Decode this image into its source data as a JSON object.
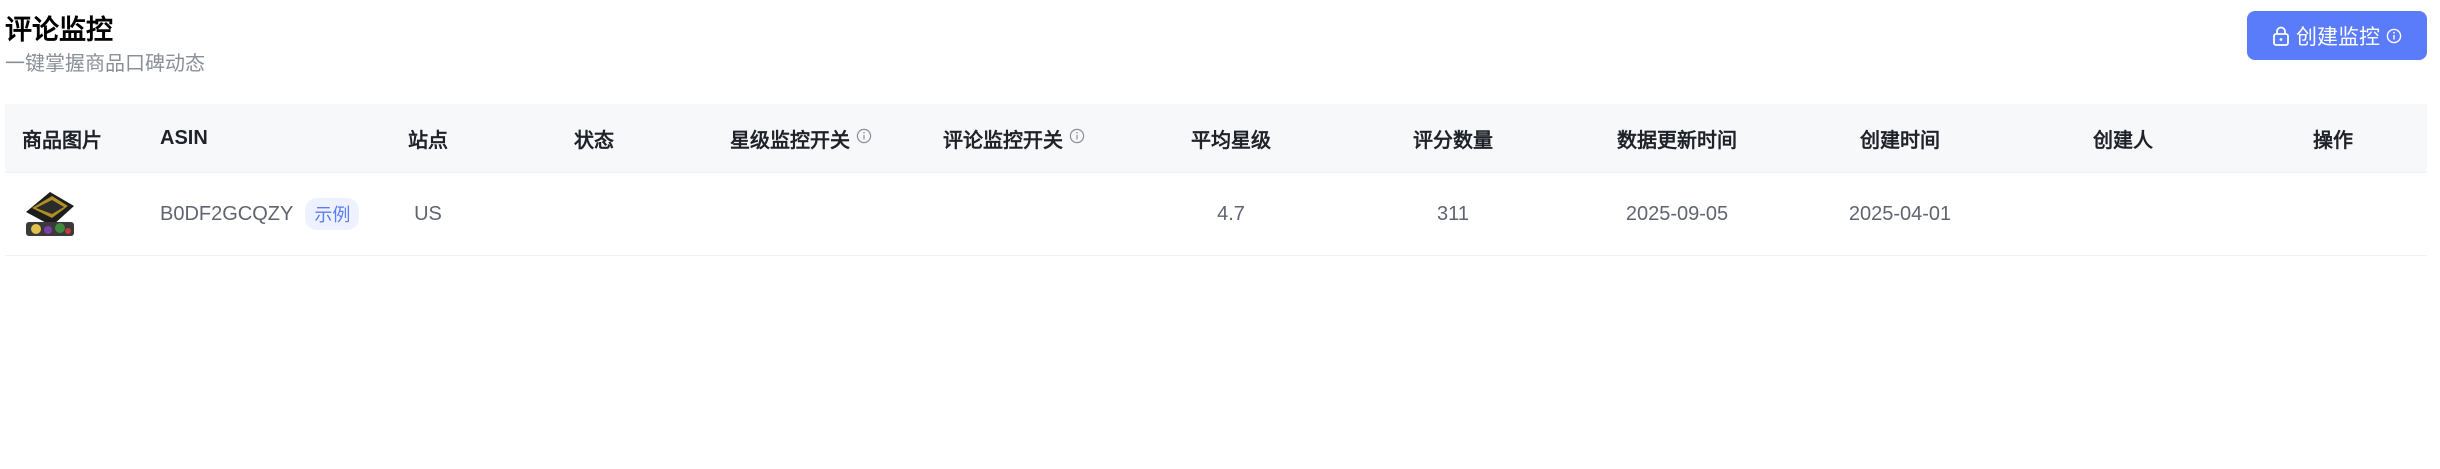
{
  "page": {
    "title": "评论监控",
    "subtitle": "一键掌握商品口碑动态",
    "create_button_label": "创建监控"
  },
  "icons": {
    "create_button_left": "lock-icon",
    "create_button_right": "info-icon",
    "column_info": "info-icon"
  },
  "colors": {
    "accent": "#5b7cfa",
    "header_bg": "#f7f8fa",
    "tag_bg": "#eef2ff"
  },
  "table": {
    "columns": [
      "商品图片",
      "ASIN",
      "站点",
      "状态",
      "星级监控开关",
      "评论监控开关",
      "平均星级",
      "评分数量",
      "数据更新时间",
      "创建时间",
      "创建人",
      "操作"
    ],
    "rows": [
      {
        "asin": "B0DF2GCQZY",
        "tag": "示例",
        "site": "US",
        "status": "",
        "star_switch": "",
        "review_switch": "",
        "avg_rating": "4.7",
        "rating_count": "311",
        "data_updated": "2025-09-05",
        "created": "2025-04-01",
        "creator": "",
        "actions": ""
      }
    ]
  }
}
